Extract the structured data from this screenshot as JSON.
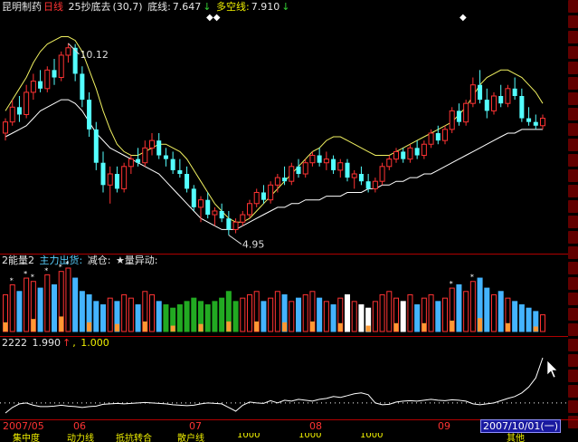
{
  "main_panel": {
    "stock_name": "昆明制药",
    "period": "日线",
    "indicator_name": "25抄底去",
    "indicator_params": "(30,7)",
    "bottom_line_label": "底线:",
    "bottom_line_value": "7.647",
    "bottom_arrow": "↓",
    "long_short_label": "多空线:",
    "long_short_value": "7.910",
    "long_short_arrow": "↓",
    "high_label": "10.12",
    "low_label": "4.95",
    "markers": [
      "◆◆",
      "◆"
    ]
  },
  "volume_panel": {
    "title": "2能量2",
    "main_out_label": "主力出货:",
    "reduce_label": "减仓:",
    "volume_abnormal_label": "★量异动:"
  },
  "indicator_panel": {
    "title": "2222",
    "value1": "1.990",
    "arrow1": "↑",
    "value2": "1.000"
  },
  "x_axis": {
    "labels": [
      "2007/05",
      "06",
      "07",
      "08",
      "09"
    ],
    "current_date": "2007/10/01(一)"
  },
  "bottom_tabs": [
    "集中度",
    "动力线",
    "抵抗转合",
    "散户线",
    "1000",
    "1000",
    "1000",
    "其他"
  ],
  "colors": {
    "up_candle": "#ff3333",
    "down_candle": "#54ffff",
    "upper_band": "#f0f060",
    "lower_band": "#ffffff",
    "grid_red": "#b00000"
  },
  "chart_data": {
    "type": "candlestick",
    "ylim": [
      4.5,
      10.8
    ],
    "candles": [
      [
        7.7,
        8.1,
        7.5,
        8.0
      ],
      [
        8.0,
        8.6,
        7.9,
        8.4
      ],
      [
        8.4,
        8.7,
        8.0,
        8.2
      ],
      [
        8.2,
        9.0,
        8.1,
        8.8
      ],
      [
        8.8,
        9.3,
        8.6,
        9.1
      ],
      [
        9.1,
        9.4,
        8.8,
        8.9
      ],
      [
        8.9,
        9.5,
        8.8,
        9.4
      ],
      [
        9.4,
        9.7,
        9.0,
        9.2
      ],
      [
        9.2,
        9.9,
        9.1,
        9.8
      ],
      [
        9.8,
        10.12,
        9.6,
        10.0
      ],
      [
        10.0,
        10.1,
        9.1,
        9.3
      ],
      [
        9.3,
        9.5,
        8.4,
        8.6
      ],
      [
        8.6,
        8.8,
        7.6,
        7.8
      ],
      [
        7.8,
        8.0,
        6.7,
        6.9
      ],
      [
        6.9,
        7.2,
        6.1,
        6.3
      ],
      [
        6.3,
        6.8,
        5.8,
        6.6
      ],
      [
        6.6,
        6.8,
        6.1,
        6.2
      ],
      [
        6.2,
        6.9,
        6.1,
        6.8
      ],
      [
        6.8,
        7.1,
        6.6,
        7.0
      ],
      [
        7.0,
        7.3,
        6.8,
        6.9
      ],
      [
        6.9,
        7.5,
        6.8,
        7.3
      ],
      [
        7.3,
        7.7,
        7.1,
        7.5
      ],
      [
        7.5,
        7.7,
        7.0,
        7.1
      ],
      [
        7.1,
        7.3,
        6.8,
        7.0
      ],
      [
        7.0,
        7.2,
        6.6,
        6.7
      ],
      [
        6.7,
        7.0,
        6.5,
        6.6
      ],
      [
        6.6,
        6.8,
        6.1,
        6.2
      ],
      [
        6.2,
        6.3,
        5.6,
        5.7
      ],
      [
        5.7,
        6.0,
        5.3,
        5.9
      ],
      [
        5.9,
        6.1,
        5.4,
        5.5
      ],
      [
        5.5,
        5.7,
        5.2,
        5.6
      ],
      [
        5.6,
        5.8,
        5.3,
        5.4
      ],
      [
        5.4,
        5.6,
        4.95,
        5.1
      ],
      [
        5.1,
        5.4,
        5.0,
        5.3
      ],
      [
        5.3,
        5.6,
        5.2,
        5.5
      ],
      [
        5.5,
        5.9,
        5.4,
        5.8
      ],
      [
        5.8,
        6.2,
        5.7,
        6.1
      ],
      [
        6.1,
        6.3,
        5.8,
        5.9
      ],
      [
        5.9,
        6.4,
        5.8,
        6.3
      ],
      [
        6.3,
        6.6,
        6.1,
        6.5
      ],
      [
        6.5,
        6.8,
        6.3,
        6.4
      ],
      [
        6.4,
        6.9,
        6.3,
        6.8
      ],
      [
        6.8,
        7.0,
        6.5,
        6.6
      ],
      [
        6.6,
        7.0,
        6.5,
        6.9
      ],
      [
        6.9,
        7.2,
        6.8,
        7.1
      ],
      [
        7.1,
        7.3,
        6.8,
        6.9
      ],
      [
        6.9,
        7.2,
        6.7,
        7.0
      ],
      [
        7.0,
        7.1,
        6.6,
        6.7
      ],
      [
        6.7,
        7.0,
        6.5,
        6.9
      ],
      [
        6.9,
        7.0,
        6.4,
        6.5
      ],
      [
        6.5,
        6.7,
        6.2,
        6.6
      ],
      [
        6.6,
        6.8,
        6.3,
        6.4
      ],
      [
        6.4,
        6.6,
        6.1,
        6.2
      ],
      [
        6.2,
        6.5,
        6.1,
        6.4
      ],
      [
        6.4,
        6.9,
        6.3,
        6.8
      ],
      [
        6.8,
        7.1,
        6.7,
        7.0
      ],
      [
        7.0,
        7.3,
        6.9,
        7.2
      ],
      [
        7.2,
        7.3,
        6.9,
        7.0
      ],
      [
        7.0,
        7.4,
        6.9,
        7.3
      ],
      [
        7.3,
        7.5,
        7.0,
        7.1
      ],
      [
        7.1,
        7.5,
        7.0,
        7.4
      ],
      [
        7.4,
        7.8,
        7.3,
        7.7
      ],
      [
        7.7,
        7.9,
        7.4,
        7.5
      ],
      [
        7.5,
        7.9,
        7.4,
        7.8
      ],
      [
        7.8,
        8.4,
        7.7,
        8.3
      ],
      [
        8.3,
        8.5,
        7.9,
        8.0
      ],
      [
        8.0,
        8.6,
        7.9,
        8.5
      ],
      [
        8.5,
        9.2,
        8.4,
        9.0
      ],
      [
        9.0,
        9.4,
        8.5,
        8.6
      ],
      [
        8.6,
        8.9,
        8.1,
        8.3
      ],
      [
        8.3,
        8.8,
        8.2,
        8.7
      ],
      [
        8.7,
        9.0,
        8.4,
        8.5
      ],
      [
        8.5,
        9.0,
        8.4,
        8.9
      ],
      [
        8.9,
        9.2,
        8.6,
        8.7
      ],
      [
        8.7,
        8.9,
        8.0,
        8.1
      ],
      [
        8.1,
        8.4,
        7.9,
        8.0
      ],
      [
        8.0,
        8.2,
        7.8,
        7.9
      ],
      [
        7.9,
        8.2,
        7.8,
        8.1
      ]
    ],
    "upper_band": [
      8.3,
      8.6,
      8.9,
      9.2,
      9.6,
      9.9,
      10.1,
      10.2,
      10.3,
      10.3,
      10.2,
      9.9,
      9.4,
      8.9,
      8.3,
      7.8,
      7.4,
      7.2,
      7.1,
      7.1,
      7.2,
      7.3,
      7.4,
      7.4,
      7.3,
      7.2,
      7.0,
      6.7,
      6.4,
      6.1,
      5.8,
      5.6,
      5.4,
      5.3,
      5.3,
      5.4,
      5.6,
      5.8,
      6.0,
      6.2,
      6.4,
      6.6,
      6.8,
      7.0,
      7.2,
      7.3,
      7.5,
      7.6,
      7.6,
      7.5,
      7.4,
      7.3,
      7.2,
      7.1,
      7.1,
      7.1,
      7.2,
      7.3,
      7.4,
      7.5,
      7.6,
      7.7,
      7.8,
      7.9,
      8.0,
      8.2,
      8.4,
      8.7,
      9.0,
      9.2,
      9.3,
      9.4,
      9.4,
      9.3,
      9.2,
      9.0,
      8.8,
      8.5
    ],
    "lower_band": [
      7.6,
      7.7,
      7.8,
      7.9,
      8.1,
      8.3,
      8.4,
      8.5,
      8.6,
      8.6,
      8.5,
      8.3,
      8.0,
      7.7,
      7.5,
      7.3,
      7.2,
      7.1,
      7.0,
      6.9,
      6.8,
      6.7,
      6.6,
      6.4,
      6.2,
      6.0,
      5.8,
      5.6,
      5.4,
      5.3,
      5.2,
      5.1,
      5.1,
      5.1,
      5.2,
      5.3,
      5.4,
      5.5,
      5.6,
      5.7,
      5.7,
      5.8,
      5.8,
      5.9,
      5.9,
      5.9,
      6.0,
      6.0,
      6.0,
      6.1,
      6.1,
      6.1,
      6.2,
      6.2,
      6.3,
      6.3,
      6.4,
      6.4,
      6.5,
      6.5,
      6.6,
      6.6,
      6.7,
      6.8,
      6.9,
      7.0,
      7.1,
      7.2,
      7.3,
      7.4,
      7.5,
      7.6,
      7.7,
      7.7,
      7.8,
      7.8,
      7.8,
      7.8
    ],
    "volumes": [
      55,
      70,
      60,
      80,
      75,
      65,
      85,
      70,
      90,
      95,
      80,
      60,
      55,
      45,
      40,
      50,
      45,
      55,
      50,
      40,
      60,
      55,
      45,
      40,
      35,
      40,
      45,
      50,
      45,
      40,
      45,
      50,
      60,
      45,
      50,
      55,
      60,
      45,
      50,
      60,
      55,
      45,
      50,
      55,
      60,
      50,
      45,
      40,
      50,
      55,
      45,
      40,
      35,
      45,
      55,
      60,
      50,
      45,
      55,
      40,
      50,
      55,
      45,
      50,
      65,
      70,
      60,
      75,
      80,
      65,
      55,
      60,
      50,
      45,
      40,
      35,
      30,
      25
    ],
    "indicator": [
      0.78,
      0.9,
      0.98,
      1.0,
      0.95,
      0.92,
      0.92,
      0.93,
      0.95,
      0.93,
      0.92,
      0.9,
      0.92,
      0.93,
      0.97,
      0.98,
      0.99,
      0.98,
      0.99,
      1.0,
      1.01,
      1.0,
      0.99,
      0.98,
      0.96,
      0.95,
      0.94,
      0.95,
      0.98,
      1.0,
      0.99,
      0.98,
      0.9,
      0.82,
      0.95,
      1.02,
      1.0,
      0.99,
      1.05,
      1.0,
      1.06,
      1.04,
      1.08,
      1.06,
      1.04,
      1.08,
      1.1,
      1.14,
      1.12,
      1.16,
      1.2,
      1.22,
      1.18,
      1.0,
      0.96,
      0.97,
      1.02,
      1.04,
      1.05,
      1.04,
      1.06,
      1.08,
      1.06,
      1.05,
      1.07,
      1.06,
      1.04,
      0.98,
      0.96,
      0.98,
      1.0,
      1.05,
      1.1,
      1.14,
      1.22,
      1.35,
      1.55,
      1.99
    ]
  }
}
